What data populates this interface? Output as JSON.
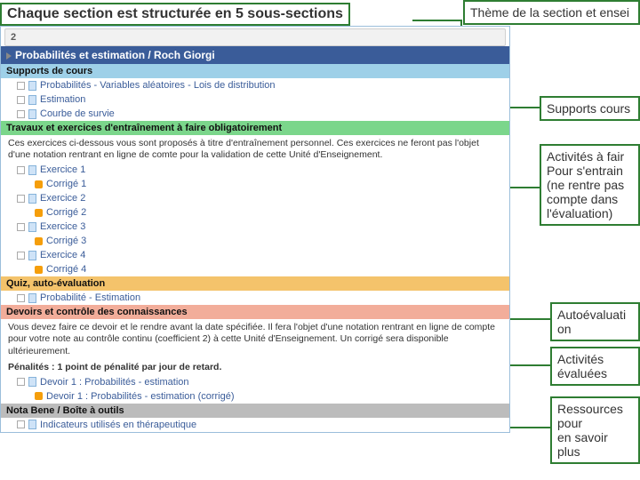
{
  "title": "Chaque section est structurée en 5 sous-sections",
  "labels": {
    "theme": "Thème de la section et ensei",
    "supports": "Supports cours",
    "activites": "Activités à fair\nPour s'entrain\n(ne rentre pas\ncompte dans\nl'évaluation)",
    "autoeval": "Autoévaluati\non",
    "evaluees": "Activités\névaluées",
    "ressources": "Ressources\npour\nen savoir\nplus"
  },
  "panel": {
    "header_blue": "Probabilités et estimation / Roch Giorgi",
    "subs": {
      "supports": "Supports de cours",
      "travaux": "Travaux et exercices d'entraînement à faire obligatoirement",
      "quiz": "Quiz, auto-évaluation",
      "devoirs": "Devoirs et contrôle des connaissances",
      "nb": "Nota Bene / Boîte à outils"
    },
    "items": {
      "s1": "Probabilités - Variables aléatoires - Lois de distribution",
      "s2": "Estimation",
      "s3": "Courbe de survie",
      "t_desc": "Ces exercices ci-dessous vous sont proposés à titre d'entraînement personnel. Ces exercices ne feront pas l'objet d'une notation rentrant en ligne de comte pour la validation de cette Unité d'Enseignement.",
      "e1": "Exercice 1",
      "c1": "Corrigé 1",
      "e2": "Exercice 2",
      "c2": "Corrigé 2",
      "e3": "Exercice 3",
      "c3": "Corrigé 3",
      "e4": "Exercice 4",
      "c4": "Corrigé 4",
      "quiz_item": "Probabilité - Estimation",
      "d_desc": "Vous devez faire ce devoir et le rendre avant la date spécifiée. Il fera l'objet d'une notation rentrant en ligne de compte pour votre note au contrôle continu (coefficient 2) à cette Unité d'Enseignement. Un corrigé sera disponible ultérieurement.",
      "d_pen": "Pénalités : 1 point de pénalité par jour de retard.",
      "d1": "Devoir 1 : Probabilités - estimation",
      "d1c": "Devoir 1 : Probabilités - estimation (corrigé)",
      "nb1": "Indicateurs utilisés en thérapeutique"
    }
  }
}
